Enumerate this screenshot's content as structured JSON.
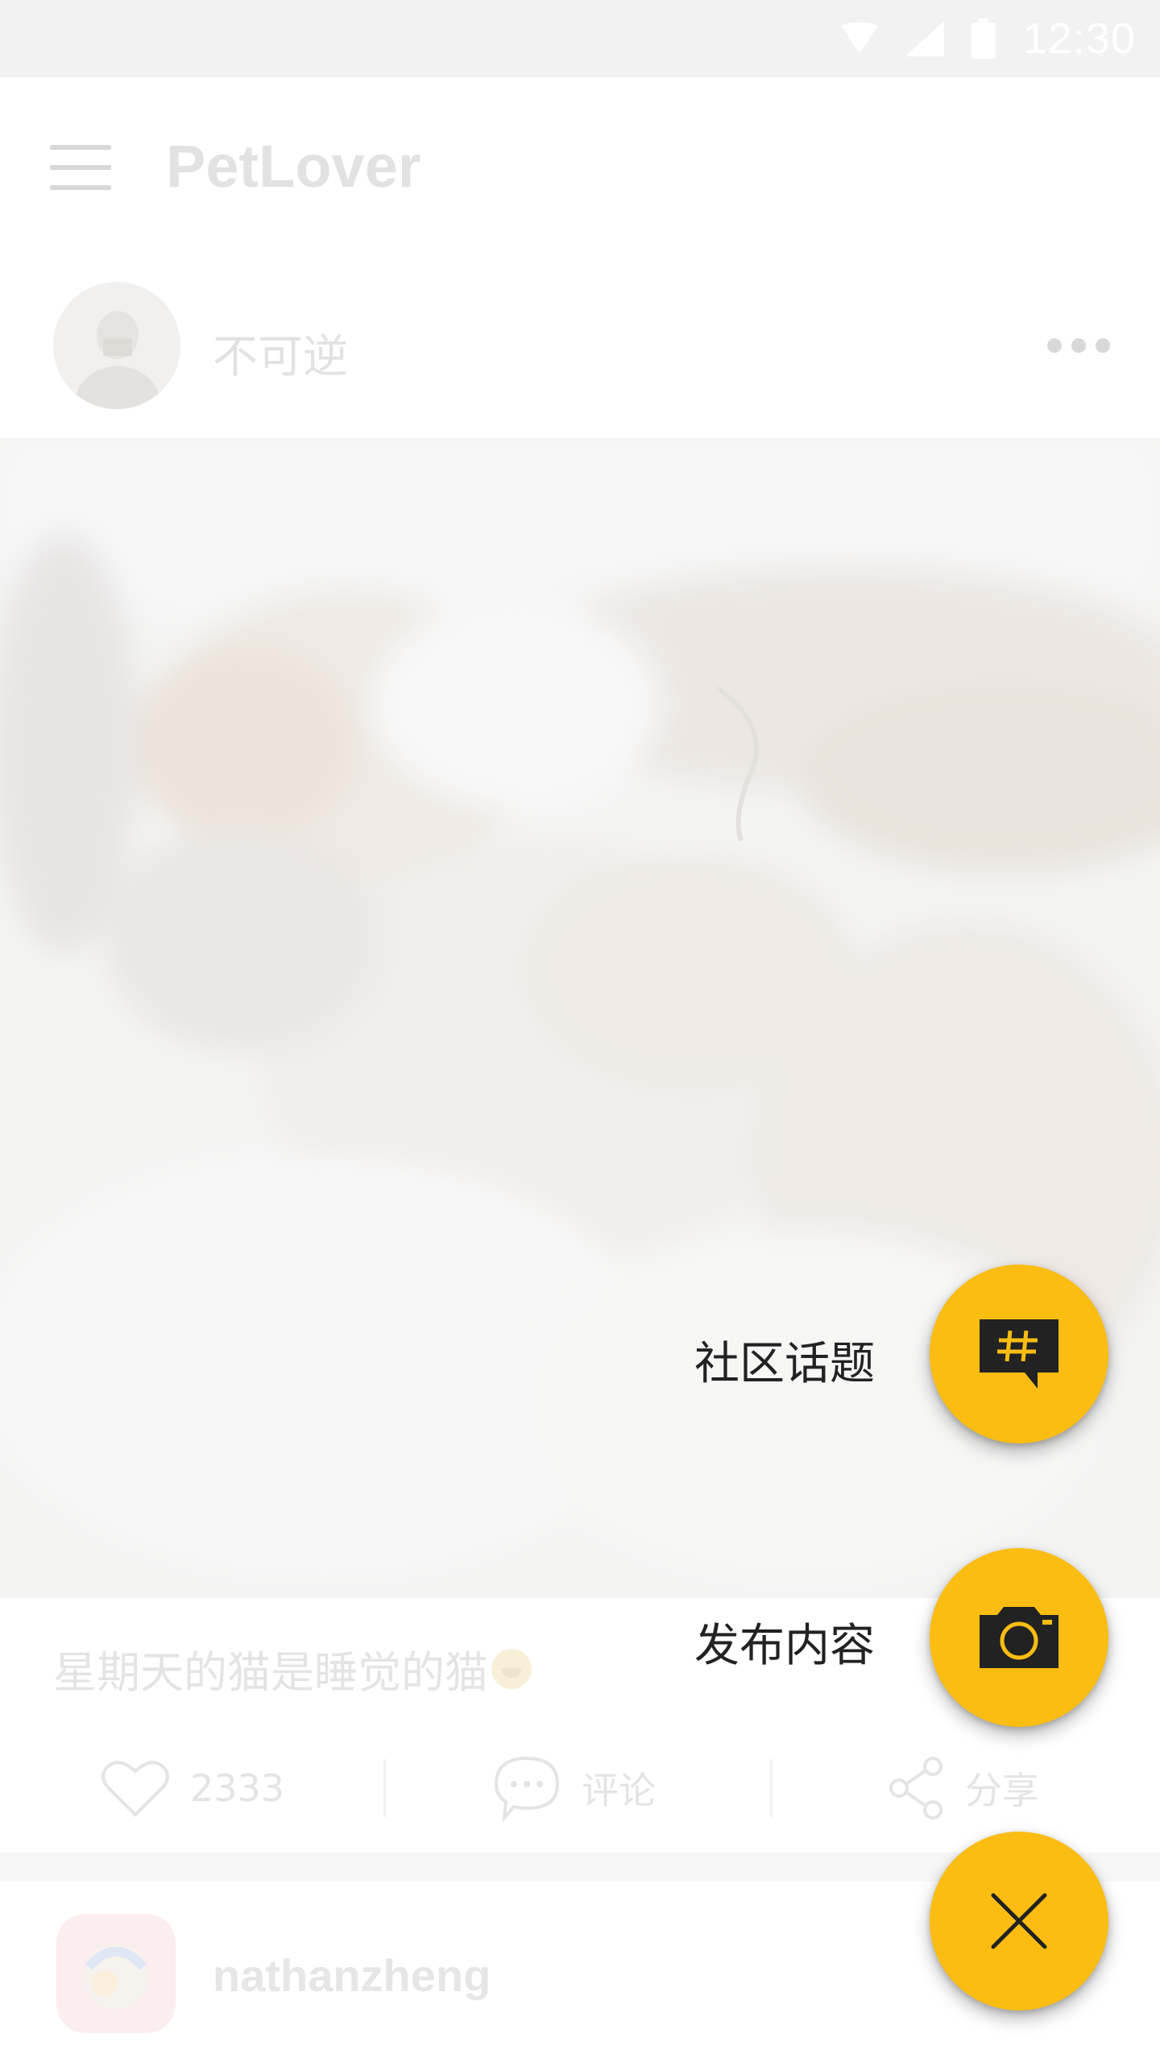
{
  "status_bar": {
    "time": "12:30",
    "icons": [
      "wifi-icon",
      "signal-icon",
      "battery-icon"
    ]
  },
  "app_bar": {
    "title": "PetLover",
    "menu_icon": "hamburger-menu-icon"
  },
  "feed": {
    "post1": {
      "author": "不可逆",
      "more_icon": "more-horizontal-icon",
      "caption": "星期天的猫是睡觉的猫",
      "caption_emoji": "grinning-face-emoji",
      "likes": "2333",
      "comment_label": "评论",
      "share_label": "分享"
    },
    "post2": {
      "author": "nathanzheng"
    }
  },
  "fab_menu": {
    "topic_label": "社区话题",
    "topic_icon": "topic-hash-icon",
    "publish_label": "发布内容",
    "publish_icon": "camera-icon",
    "close_icon": "close-icon"
  },
  "colors": {
    "accent": "#fbbd12",
    "scrim_text": "#e2e2e2",
    "fab_icon": "#222222"
  }
}
